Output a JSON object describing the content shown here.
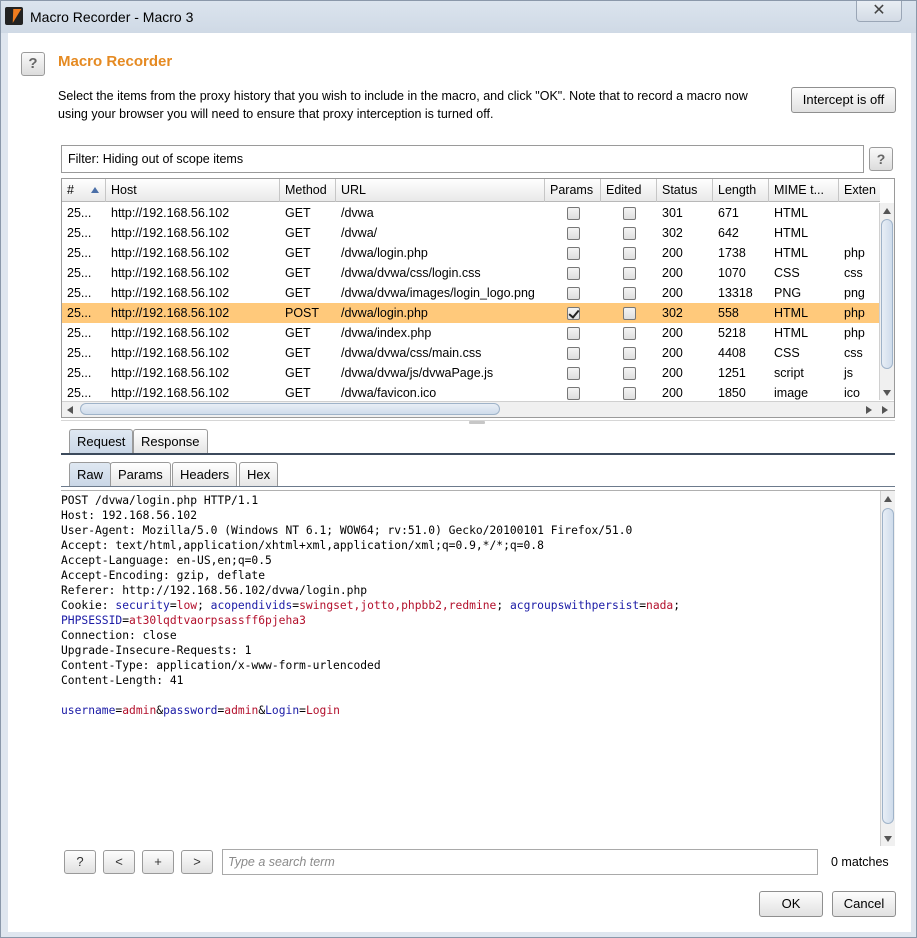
{
  "window": {
    "title": "Macro Recorder - Macro 3",
    "close_icon": "✕"
  },
  "header": {
    "help_icon": "?",
    "title": "Macro Recorder",
    "instructions": "Select the items from the proxy history that you wish to include in the macro, and click \"OK\". Note that to record a macro now using your browser you will need to ensure that proxy interception is turned off.",
    "intercept_label": "Intercept is off"
  },
  "filter": {
    "text": "Filter: Hiding out of scope items",
    "help_icon": "?"
  },
  "table": {
    "columns": [
      "#",
      "Host",
      "Method",
      "URL",
      "Params",
      "Edited",
      "Status",
      "Length",
      "MIME t...",
      "Exten"
    ],
    "rows": [
      {
        "num": "25...",
        "host": "http://192.168.56.102",
        "method": "GET",
        "url": "/dvwa",
        "params": false,
        "edited": false,
        "status": "301",
        "length": "671",
        "mime": "HTML",
        "ext": ""
      },
      {
        "num": "25...",
        "host": "http://192.168.56.102",
        "method": "GET",
        "url": "/dvwa/",
        "params": false,
        "edited": false,
        "status": "302",
        "length": "642",
        "mime": "HTML",
        "ext": ""
      },
      {
        "num": "25...",
        "host": "http://192.168.56.102",
        "method": "GET",
        "url": "/dvwa/login.php",
        "params": false,
        "edited": false,
        "status": "200",
        "length": "1738",
        "mime": "HTML",
        "ext": "php"
      },
      {
        "num": "25...",
        "host": "http://192.168.56.102",
        "method": "GET",
        "url": "/dvwa/dvwa/css/login.css",
        "params": false,
        "edited": false,
        "status": "200",
        "length": "1070",
        "mime": "CSS",
        "ext": "css"
      },
      {
        "num": "25...",
        "host": "http://192.168.56.102",
        "method": "GET",
        "url": "/dvwa/dvwa/images/login_logo.png",
        "params": false,
        "edited": false,
        "status": "200",
        "length": "13318",
        "mime": "PNG",
        "ext": "png"
      },
      {
        "num": "25...",
        "host": "http://192.168.56.102",
        "method": "POST",
        "url": "/dvwa/login.php",
        "params": true,
        "edited": false,
        "status": "302",
        "length": "558",
        "mime": "HTML",
        "ext": "php",
        "selected": true
      },
      {
        "num": "25...",
        "host": "http://192.168.56.102",
        "method": "GET",
        "url": "/dvwa/index.php",
        "params": false,
        "edited": false,
        "status": "200",
        "length": "5218",
        "mime": "HTML",
        "ext": "php"
      },
      {
        "num": "25...",
        "host": "http://192.168.56.102",
        "method": "GET",
        "url": "/dvwa/dvwa/css/main.css",
        "params": false,
        "edited": false,
        "status": "200",
        "length": "4408",
        "mime": "CSS",
        "ext": "css"
      },
      {
        "num": "25...",
        "host": "http://192.168.56.102",
        "method": "GET",
        "url": "/dvwa/dvwa/js/dvwaPage.js",
        "params": false,
        "edited": false,
        "status": "200",
        "length": "1251",
        "mime": "script",
        "ext": "js"
      },
      {
        "num": "25...",
        "host": "http://192.168.56.102",
        "method": "GET",
        "url": "/dvwa/favicon.ico",
        "params": false,
        "edited": false,
        "status": "200",
        "length": "1850",
        "mime": "image",
        "ext": "ico"
      }
    ]
  },
  "tabs": {
    "request": "Request",
    "response": "Response"
  },
  "subtabs": {
    "raw": "Raw",
    "params": "Params",
    "headers": "Headers",
    "hex": "Hex"
  },
  "editor": {
    "lines": [
      [
        {
          "t": "POST /dvwa/login.php HTTP/1.1"
        }
      ],
      [
        {
          "t": "Host: 192.168.56.102"
        }
      ],
      [
        {
          "t": "User-Agent: Mozilla/5.0 (Windows NT 6.1; WOW64; rv:51.0) Gecko/20100101 Firefox/51.0"
        }
      ],
      [
        {
          "t": "Accept: text/html,application/xhtml+xml,application/xml;q=0.9,*/*;q=0.8"
        }
      ],
      [
        {
          "t": "Accept-Language: en-US,en;q=0.5"
        }
      ],
      [
        {
          "t": "Accept-Encoding: gzip, deflate"
        }
      ],
      [
        {
          "t": "Referer: http://192.168.56.102/dvwa/login.php"
        }
      ],
      [
        {
          "t": "Cookie: "
        },
        {
          "t": "security",
          "c": "k"
        },
        {
          "t": "="
        },
        {
          "t": "low",
          "c": "v"
        },
        {
          "t": "; "
        },
        {
          "t": "acopendivids",
          "c": "k"
        },
        {
          "t": "="
        },
        {
          "t": "swingset,jotto,phpbb2,redmine",
          "c": "v"
        },
        {
          "t": "; "
        },
        {
          "t": "acgroupswithpersist",
          "c": "k"
        },
        {
          "t": "="
        },
        {
          "t": "nada",
          "c": "v"
        },
        {
          "t": ";"
        }
      ],
      [
        {
          "t": "PHPSESSID",
          "c": "k"
        },
        {
          "t": "="
        },
        {
          "t": "at30lqdtvaorpsassff6pjeha3",
          "c": "v"
        }
      ],
      [
        {
          "t": "Connection: close"
        }
      ],
      [
        {
          "t": "Upgrade-Insecure-Requests: 1"
        }
      ],
      [
        {
          "t": "Content-Type: application/x-www-form-urlencoded"
        }
      ],
      [
        {
          "t": "Content-Length: 41"
        }
      ],
      [
        {
          "t": ""
        }
      ],
      [
        {
          "t": "username",
          "c": "k"
        },
        {
          "t": "="
        },
        {
          "t": "admin",
          "c": "v"
        },
        {
          "t": "&"
        },
        {
          "t": "password",
          "c": "k"
        },
        {
          "t": "="
        },
        {
          "t": "admin",
          "c": "v"
        },
        {
          "t": "&"
        },
        {
          "t": "Login",
          "c": "k"
        },
        {
          "t": "="
        },
        {
          "t": "Login",
          "c": "v"
        }
      ]
    ]
  },
  "search": {
    "help": "?",
    "prev": "<",
    "add": "+",
    "next": ">",
    "placeholder": "Type a search term",
    "matches": "0 matches"
  },
  "footer": {
    "ok": "OK",
    "cancel": "Cancel"
  }
}
